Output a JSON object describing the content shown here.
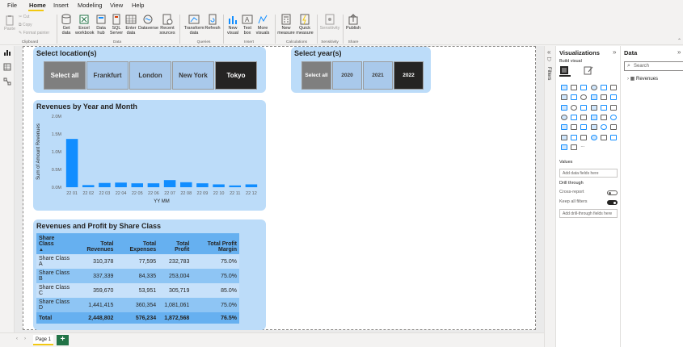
{
  "menu": {
    "items": [
      "File",
      "Home",
      "Insert",
      "Modeling",
      "View",
      "Help"
    ],
    "active": "Home"
  },
  "ribbon": {
    "clipboard": {
      "paste": "Paste",
      "cut": "Cut",
      "copy": "Copy",
      "format_painter": "Format painter",
      "group": "Clipboard"
    },
    "data": {
      "get_data": "Get data",
      "excel": "Excel workbook",
      "hub": "Data hub",
      "sql": "SQL Server",
      "enter": "Enter data",
      "dataverse": "Dataverse",
      "recent": "Recent sources",
      "group": "Data"
    },
    "queries": {
      "transform": "Transform data",
      "refresh": "Refresh",
      "group": "Queries"
    },
    "insert": {
      "new_visual": "New visual",
      "text_box": "Text box",
      "more_visuals": "More visuals",
      "group": "Insert"
    },
    "calculations": {
      "new_measure": "New measure",
      "quick_measure": "Quick measure",
      "group": "Calculations"
    },
    "sensitivity": {
      "label": "Sensitivity",
      "group": "Sensitivity"
    },
    "share": {
      "publish": "Publish",
      "group": "Share"
    }
  },
  "location_slicer": {
    "title": "Select location(s)",
    "buttons": [
      {
        "label": "Select all",
        "state": "all"
      },
      {
        "label": "Frankfurt",
        "state": "unsel"
      },
      {
        "label": "London",
        "state": "unsel"
      },
      {
        "label": "New York",
        "state": "unsel"
      },
      {
        "label": "Tokyo",
        "state": "sel"
      }
    ]
  },
  "year_slicer": {
    "title": "Select year(s)",
    "buttons": [
      {
        "label": "Select all",
        "state": "all"
      },
      {
        "label": "2020",
        "state": "unsel"
      },
      {
        "label": "2021",
        "state": "unsel"
      },
      {
        "label": "2022",
        "state": "sel"
      }
    ]
  },
  "revenue_chart": {
    "title": "Revenues by Year and Month"
  },
  "chart_data": {
    "type": "bar",
    "title": "Revenues by Year and Month",
    "xlabel": "YY MM",
    "ylabel": "Sum of Amount Revenues",
    "categories": [
      "22 01",
      "22 02",
      "22 03",
      "22 04",
      "22 05",
      "22 06",
      "22 07",
      "22 08",
      "22 09",
      "22 10",
      "22 11",
      "22 12"
    ],
    "values": [
      1360000,
      60000,
      120000,
      130000,
      110000,
      110000,
      200000,
      140000,
      110000,
      80000,
      50000,
      80000
    ],
    "ylim": [
      0,
      2000000
    ],
    "yticks": [
      "0.0M",
      "0.5M",
      "1.0M",
      "1.5M",
      "2.0M"
    ],
    "bar_color": "#118dff",
    "grid": false
  },
  "profit_table": {
    "title": "Revenues and Profit by Share Class",
    "headers": [
      "Share Class",
      "Total Revenues",
      "Total Expenses",
      "Total Profit",
      "Total Profit Margin"
    ],
    "sort_indicator": "▲",
    "rows": [
      [
        "Share Class A",
        "310,378",
        "77,595",
        "232,783",
        "75.0%"
      ],
      [
        "Share Class B",
        "337,339",
        "84,335",
        "253,004",
        "75.0%"
      ],
      [
        "Share Class C",
        "359,670",
        "53,951",
        "305,719",
        "85.0%"
      ],
      [
        "Share Class D",
        "1,441,415",
        "360,354",
        "1,081,061",
        "75.0%"
      ]
    ],
    "total": [
      "Total",
      "2,448,802",
      "576,234",
      "1,872,568",
      "76.5%"
    ]
  },
  "pages": {
    "tabs": [
      "Page 1"
    ],
    "add": "+"
  },
  "filters": {
    "label": "Filters"
  },
  "visualizations": {
    "title": "Visualizations",
    "build_visual": "Build visual",
    "values_label": "Values",
    "values_placeholder": "Add data fields here",
    "drill_through": "Drill through",
    "cross_report": "Cross-report",
    "cross_report_state": "Off",
    "keep_all_filters": "Keep all filters",
    "keep_all_filters_state": "On",
    "drill_placeholder": "Add drill-through fields here",
    "more": "..."
  },
  "data_pane": {
    "title": "Data",
    "search_placeholder": "Search",
    "tables": [
      "Revenues"
    ]
  }
}
